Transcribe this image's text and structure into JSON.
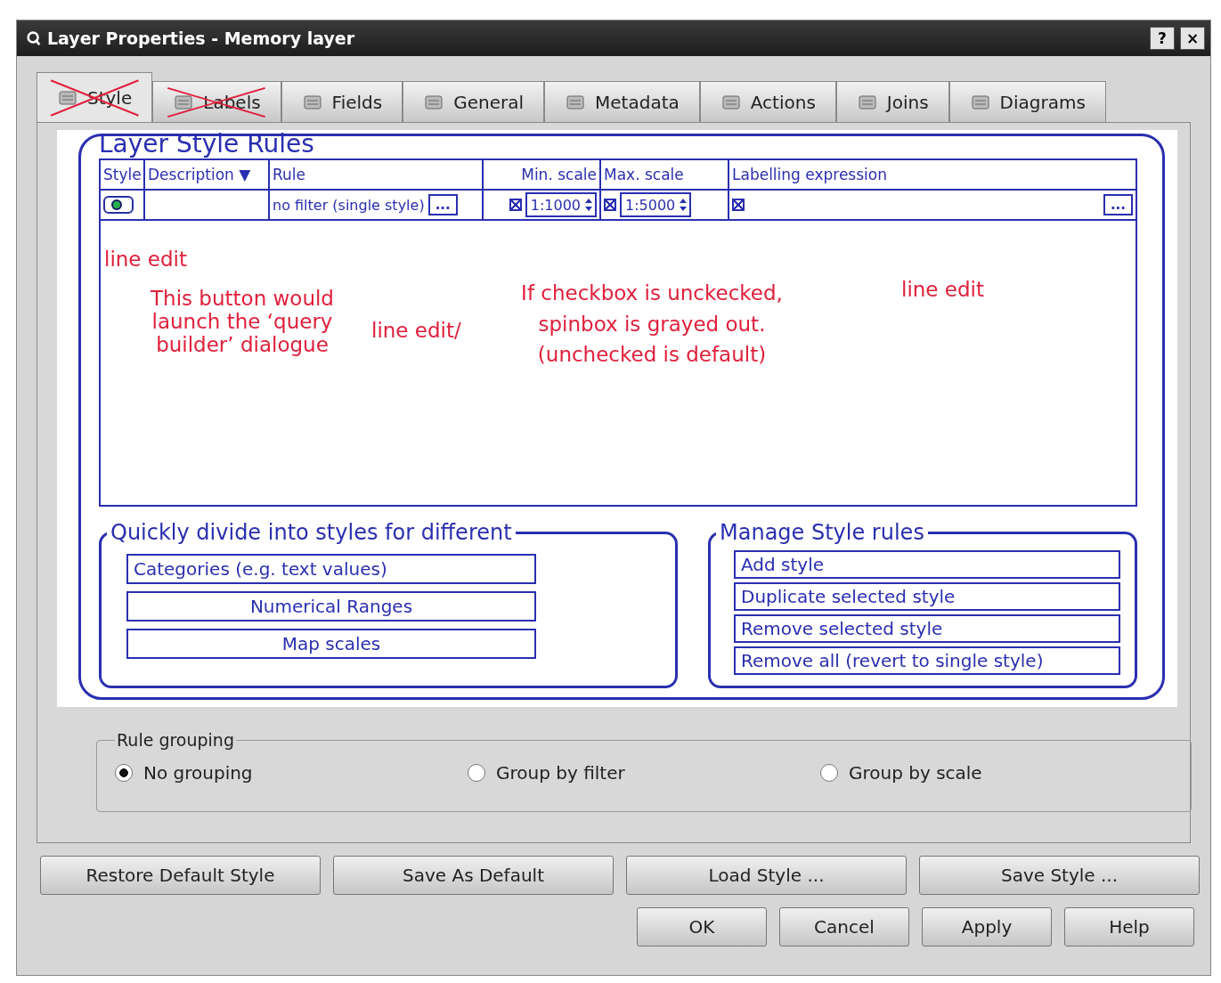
{
  "window": {
    "title": "Layer Properties - Memory layer",
    "help_button": "?",
    "close_button": "×"
  },
  "tabs": [
    {
      "label": "Style",
      "selected": true,
      "crossed_out": true
    },
    {
      "label": "Labels",
      "selected": false,
      "crossed_out": true
    },
    {
      "label": "Fields",
      "selected": false,
      "crossed_out": false
    },
    {
      "label": "General",
      "selected": false,
      "crossed_out": false
    },
    {
      "label": "Metadata",
      "selected": false,
      "crossed_out": false
    },
    {
      "label": "Actions",
      "selected": false,
      "crossed_out": false
    },
    {
      "label": "Joins",
      "selected": false,
      "crossed_out": false
    },
    {
      "label": "Diagrams",
      "selected": false,
      "crossed_out": false
    }
  ],
  "sketch": {
    "title": "Layer Style Rules",
    "columns": [
      "Style",
      "Description ▼",
      "Rule",
      "Min. scale",
      "Max. scale",
      "Labelling expression"
    ],
    "row": {
      "rule": "no filter (single style)",
      "rule_button": "...",
      "min_scale": {
        "checked": true,
        "value": "1:1000"
      },
      "max_scale": {
        "checked": true,
        "value": "1:5000"
      },
      "label_checked": true,
      "label_button": "..."
    },
    "notes": [
      {
        "kind": "left",
        "text": "line edit"
      },
      {
        "kind": "query",
        "text": "This button would launch the ‘query builder’ dialogue"
      },
      {
        "kind": "middle",
        "text": "line edit/"
      },
      {
        "kind": "checkbox",
        "text": "If checkbox is unckecked, spinbox is grayed out. (unchecked is default)"
      },
      {
        "kind": "right",
        "text": "line edit"
      }
    ],
    "divide": {
      "title": "Quickly divide into styles for different",
      "buttons": [
        "Categories (e.g. text values)",
        "Numerical Ranges",
        "Map scales"
      ]
    },
    "manage": {
      "title": "Manage Style rules",
      "buttons": [
        "Add style",
        "Duplicate selected style",
        "Remove selected style",
        "Remove all (revert to single style)"
      ]
    }
  },
  "rule_grouping": {
    "title": "Rule grouping",
    "options": [
      {
        "label": "No grouping",
        "selected": true
      },
      {
        "label": "Group by filter",
        "selected": false
      },
      {
        "label": "Group by scale",
        "selected": false
      }
    ]
  },
  "style_buttons": [
    "Restore Default Style",
    "Save As Default",
    "Load Style ...",
    "Save Style ..."
  ],
  "dialog_buttons": [
    "OK",
    "Cancel",
    "Apply",
    "Help"
  ]
}
